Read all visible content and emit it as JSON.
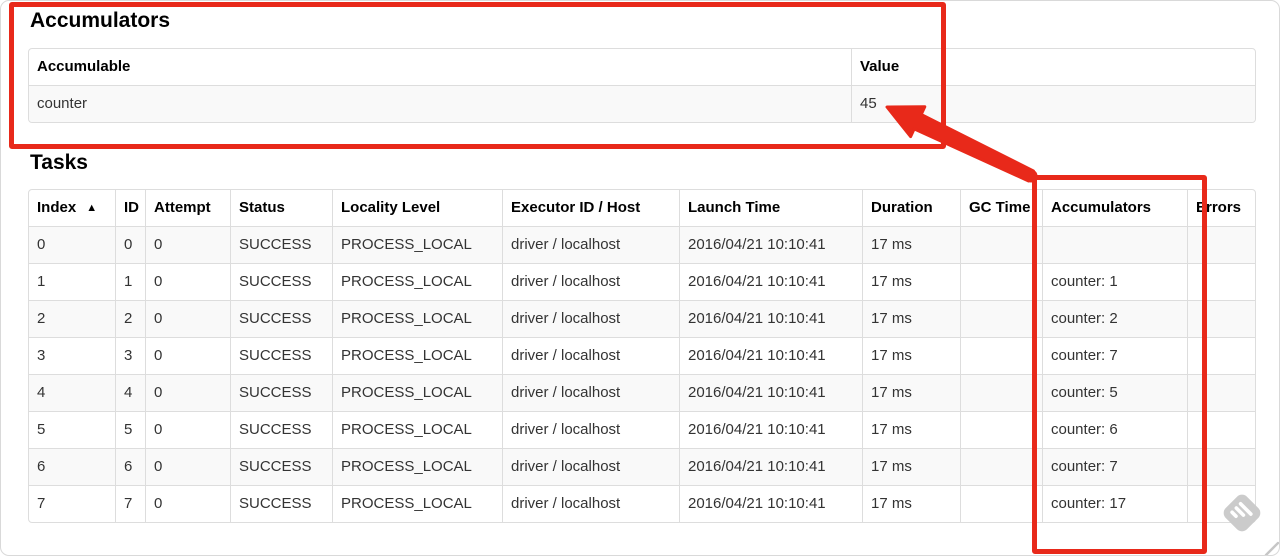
{
  "accumulators_section": {
    "heading": "Accumulators",
    "table": {
      "headers": [
        "Accumulable",
        "Value"
      ],
      "rows": [
        {
          "accumulable": "counter",
          "value": "45"
        }
      ]
    }
  },
  "tasks_section": {
    "heading": "Tasks",
    "table": {
      "headers": [
        "Index",
        "ID",
        "Attempt",
        "Status",
        "Locality Level",
        "Executor ID / Host",
        "Launch Time",
        "Duration",
        "GC Time",
        "Accumulators",
        "Errors"
      ],
      "sort_icon": "▲",
      "rows": [
        {
          "index": "0",
          "id": "0",
          "attempt": "0",
          "status": "SUCCESS",
          "locality_level": "PROCESS_LOCAL",
          "executor_id_host": "driver / localhost",
          "launch_time": "2016/04/21 10:10:41",
          "duration": "17 ms",
          "gc_time": "",
          "accumulators": "",
          "errors": ""
        },
        {
          "index": "1",
          "id": "1",
          "attempt": "0",
          "status": "SUCCESS",
          "locality_level": "PROCESS_LOCAL",
          "executor_id_host": "driver / localhost",
          "launch_time": "2016/04/21 10:10:41",
          "duration": "17 ms",
          "gc_time": "",
          "accumulators": "counter: 1",
          "errors": ""
        },
        {
          "index": "2",
          "id": "2",
          "attempt": "0",
          "status": "SUCCESS",
          "locality_level": "PROCESS_LOCAL",
          "executor_id_host": "driver / localhost",
          "launch_time": "2016/04/21 10:10:41",
          "duration": "17 ms",
          "gc_time": "",
          "accumulators": "counter: 2",
          "errors": ""
        },
        {
          "index": "3",
          "id": "3",
          "attempt": "0",
          "status": "SUCCESS",
          "locality_level": "PROCESS_LOCAL",
          "executor_id_host": "driver / localhost",
          "launch_time": "2016/04/21 10:10:41",
          "duration": "17 ms",
          "gc_time": "",
          "accumulators": "counter: 7",
          "errors": ""
        },
        {
          "index": "4",
          "id": "4",
          "attempt": "0",
          "status": "SUCCESS",
          "locality_level": "PROCESS_LOCAL",
          "executor_id_host": "driver / localhost",
          "launch_time": "2016/04/21 10:10:41",
          "duration": "17 ms",
          "gc_time": "",
          "accumulators": "counter: 5",
          "errors": ""
        },
        {
          "index": "5",
          "id": "5",
          "attempt": "0",
          "status": "SUCCESS",
          "locality_level": "PROCESS_LOCAL",
          "executor_id_host": "driver / localhost",
          "launch_time": "2016/04/21 10:10:41",
          "duration": "17 ms",
          "gc_time": "",
          "accumulators": "counter: 6",
          "errors": ""
        },
        {
          "index": "6",
          "id": "6",
          "attempt": "0",
          "status": "SUCCESS",
          "locality_level": "PROCESS_LOCAL",
          "executor_id_host": "driver / localhost",
          "launch_time": "2016/04/21 10:10:41",
          "duration": "17 ms",
          "gc_time": "",
          "accumulators": "counter: 7",
          "errors": ""
        },
        {
          "index": "7",
          "id": "7",
          "attempt": "0",
          "status": "SUCCESS",
          "locality_level": "PROCESS_LOCAL",
          "executor_id_host": "driver / localhost",
          "launch_time": "2016/04/21 10:10:41",
          "duration": "17 ms",
          "gc_time": "",
          "accumulators": "counter: 17",
          "errors": ""
        }
      ]
    }
  },
  "annotations": {
    "highlight_color": "#e8291a",
    "arrow_points_to": "45"
  },
  "watermark": {
    "icon": "feedly-logo",
    "color": "#cbcbcb"
  }
}
